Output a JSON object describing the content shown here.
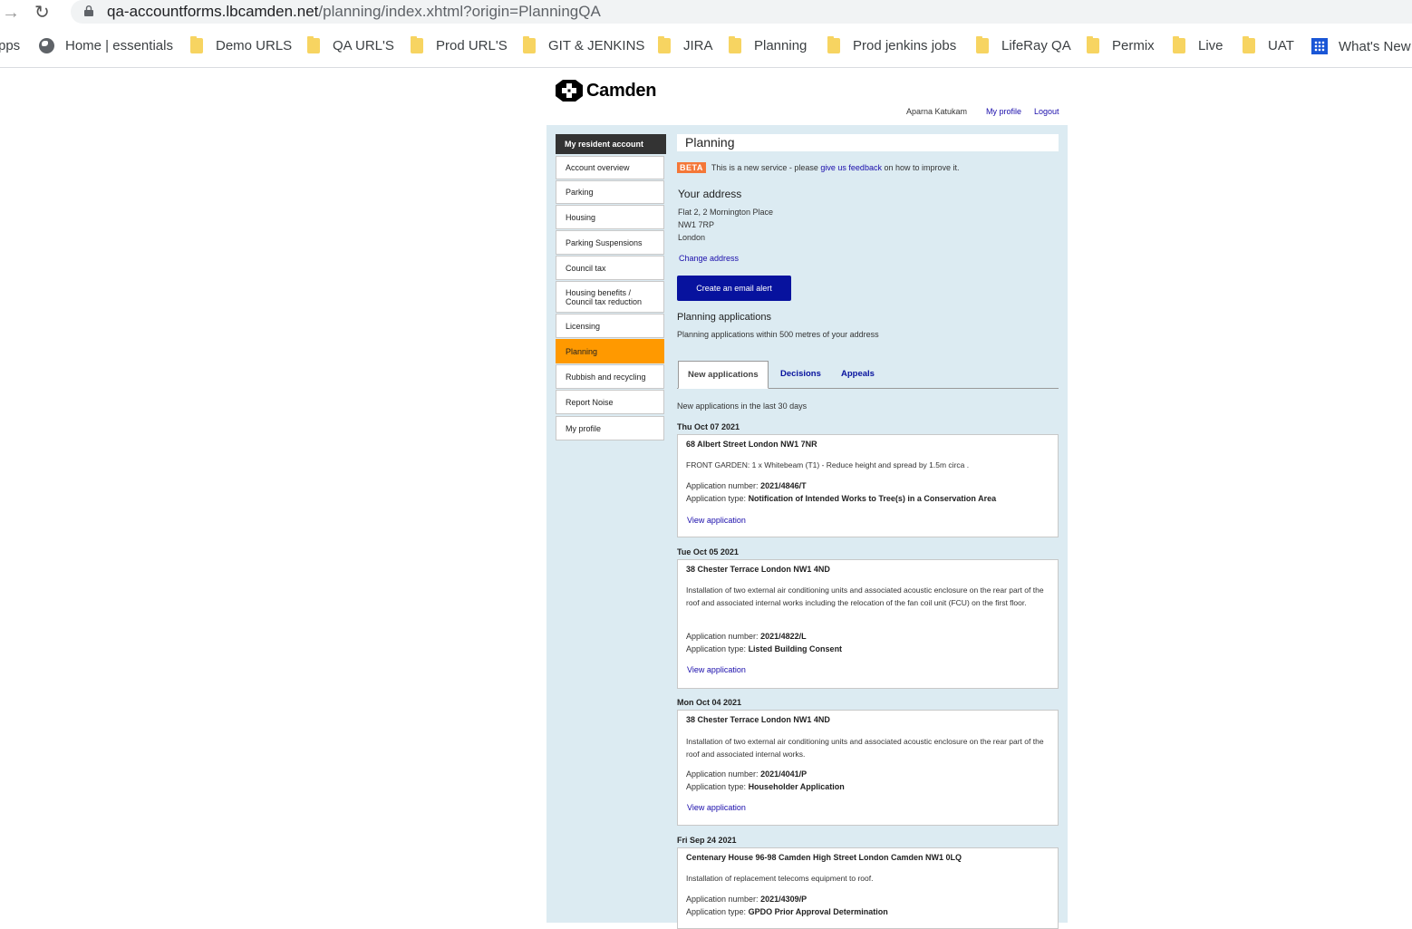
{
  "browser": {
    "url_host": "qa-accountforms.lbcamden.net",
    "url_path": "/planning/index.xhtml?origin=PlanningQA",
    "bookmarks": [
      {
        "label": "pps",
        "icon": "apps-partial"
      },
      {
        "label": "Home | essentials",
        "icon": "globe-icon"
      },
      {
        "label": "Demo URLS",
        "icon": "folder-icon"
      },
      {
        "label": "QA URL'S",
        "icon": "folder-icon"
      },
      {
        "label": "Prod URL'S",
        "icon": "folder-icon"
      },
      {
        "label": "GIT & JENKINS",
        "icon": "folder-icon"
      },
      {
        "label": "JIRA",
        "icon": "folder-icon"
      },
      {
        "label": "Planning",
        "icon": "folder-icon"
      },
      {
        "label": "Prod jenkins jobs",
        "icon": "folder-icon"
      },
      {
        "label": "LifeRay QA",
        "icon": "folder-icon"
      },
      {
        "label": "Permix",
        "icon": "folder-icon"
      },
      {
        "label": "Live",
        "icon": "folder-icon"
      },
      {
        "label": "UAT",
        "icon": "folder-icon"
      },
      {
        "label": "What's New",
        "icon": "grid-icon"
      }
    ]
  },
  "header": {
    "logo_text": "Camden",
    "user_name": "Aparna Katukam",
    "my_profile": "My profile",
    "logout": "Logout"
  },
  "sidebar": {
    "heading": "My resident account",
    "items": [
      {
        "label": "Account overview"
      },
      {
        "label": "Parking"
      },
      {
        "label": "Housing"
      },
      {
        "label": "Parking Suspensions"
      },
      {
        "label": "Council tax"
      },
      {
        "label": "Housing benefits /",
        "label2": "Council tax reduction"
      },
      {
        "label": "Licensing"
      },
      {
        "label": "Planning",
        "active": true
      },
      {
        "label": "Rubbish and recycling"
      },
      {
        "label": "Report Noise"
      },
      {
        "label": "My profile"
      }
    ]
  },
  "main": {
    "title": "Planning",
    "beta": {
      "badge": "BETA",
      "text_before": "This is a new service - please",
      "link": "give us feedback",
      "text_after": "on how to improve it."
    },
    "address": {
      "heading": "Your address",
      "lines": [
        "Flat 2, 2 Mornington Place",
        "NW1 7RP",
        "London"
      ],
      "change_link": "Change address"
    },
    "alert_button": "Create an email alert",
    "applications_heading": "Planning applications",
    "applications_sub": "Planning applications within 500 metres of your address",
    "tabs": [
      {
        "label": "New applications",
        "active": true
      },
      {
        "label": "Decisions"
      },
      {
        "label": "Appeals"
      }
    ],
    "new_note": "New applications in the last 30 days",
    "number_label": "Application number:",
    "type_label": "Application type:",
    "view_label": "View application",
    "applications": [
      {
        "date": "Thu Oct 07 2021",
        "address": "68 Albert Street London NW1 7NR",
        "description": "FRONT GARDEN: 1 x Whitebeam (T1) - Reduce height and spread by 1.5m circa .",
        "number": "2021/4846/T",
        "type": "Notification of Intended Works to Tree(s) in a Conservation Area"
      },
      {
        "date": "Tue Oct 05 2021",
        "address": "38 Chester Terrace London NW1 4ND",
        "description": "Installation of two external air conditioning units and associated acoustic enclosure on the rear part of the roof and associated internal works including the relocation of the fan coil unit (FCU) on the first floor.",
        "number": "2021/4822/L",
        "type": "Listed Building Consent"
      },
      {
        "date": "Mon Oct 04 2021",
        "address": "38 Chester Terrace London NW1 4ND",
        "description": "Installation of two external air conditioning units and associated acoustic enclosure on the rear part of the roof and associated internal works.",
        "number": "2021/4041/P",
        "type": "Householder Application"
      },
      {
        "date": "Fri Sep 24 2021",
        "address": "Centenary House 96-98 Camden High Street London Camden NW1 0LQ",
        "description": "Installation of replacement telecoms equipment to roof.",
        "number": "2021/4309/P",
        "type": "GPDO Prior Approval Determination"
      }
    ]
  }
}
